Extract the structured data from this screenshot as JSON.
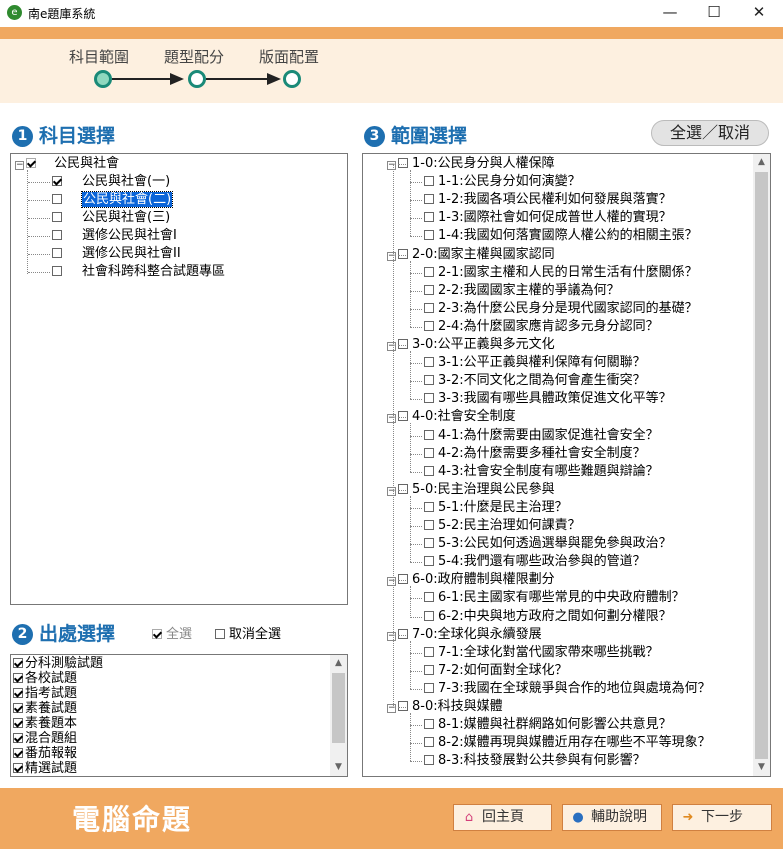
{
  "window": {
    "title": "南e題庫系統",
    "minimize": "—",
    "maximize": "☐",
    "close": "✕"
  },
  "steps": [
    "科目範圍",
    "題型配分",
    "版面配置"
  ],
  "section1": {
    "num": "1",
    "title": "科目選擇"
  },
  "subjects": {
    "root": {
      "label": "公民與社會",
      "checked": true
    },
    "items": [
      {
        "label": "公民與社會(一)",
        "checked": true,
        "selected": false
      },
      {
        "label": "公民與社會(二)",
        "checked": false,
        "selected": true
      },
      {
        "label": "公民與社會(三)",
        "checked": false,
        "selected": false
      },
      {
        "label": "選修公民與社會I",
        "checked": false,
        "selected": false
      },
      {
        "label": "選修公民與社會II",
        "checked": false,
        "selected": false
      },
      {
        "label": "社會科跨科整合試題專區",
        "checked": false,
        "selected": false
      }
    ]
  },
  "section2": {
    "num": "2",
    "title": "出處選擇",
    "select_all": "全選",
    "deselect_all": "取消全選"
  },
  "sources": [
    "分科測驗試題",
    "各校試題",
    "指考試題",
    "素養試題",
    "素養題本",
    "混合題組",
    "番茄報報",
    "精選試題"
  ],
  "section3": {
    "num": "3",
    "title": "範圍選擇",
    "toggle_button": "全選／取消"
  },
  "ranges": [
    {
      "label": "1-0:公民身分與人權保障",
      "children": [
        "1-1:公民身分如何演變？",
        "1-2:我國各項公民權利如何發展與落實？",
        "1-3:國際社會如何促成普世人權的實現？",
        "1-4:我國如何落實國際人權公約的相關主張？"
      ]
    },
    {
      "label": "2-0:國家主權與國家認同",
      "children": [
        "2-1:國家主權和人民的日常生活有什麼關係？",
        "2-2:我國國家主權的爭議為何？",
        "2-3:為什麼公民身分是現代國家認同的基礎？",
        "2-4:為什麼國家應肯認多元身分認同？"
      ]
    },
    {
      "label": "3-0:公平正義與多元文化",
      "children": [
        "3-1:公平正義與權利保障有何關聯？",
        "3-2:不同文化之間為何會產生衝突？",
        "3-3:我國有哪些具體政策促進文化平等？"
      ]
    },
    {
      "label": "4-0:社會安全制度",
      "children": [
        "4-1:為什麼需要由國家促進社會安全？",
        "4-2:為什麼需要多種社會安全制度？",
        "4-3:社會安全制度有哪些難題與辯論？"
      ]
    },
    {
      "label": "5-0:民主治理與公民參與",
      "children": [
        "5-1:什麼是民主治理？",
        "5-2:民主治理如何課責？",
        "5-3:公民如何透過選舉與罷免參與政治？",
        "5-4:我們還有哪些政治參與的管道？"
      ]
    },
    {
      "label": "6-0:政府體制與權限劃分",
      "children": [
        "6-1:民主國家有哪些常見的中央政府體制？",
        "6-2:中央與地方政府之間如何劃分權限？"
      ]
    },
    {
      "label": "7-0:全球化與永續發展",
      "children": [
        "7-1:全球化對當代國家帶來哪些挑戰？",
        "7-2:如何面對全球化？",
        "7-3:我國在全球競爭與合作的地位與處境為何？"
      ]
    },
    {
      "label": "8-0:科技與媒體",
      "children": [
        "8-1:媒體與社群網路如何影響公共意見？",
        "8-2:媒體再現與媒體近用存在哪些不平等現象？",
        "8-3:科技發展對公共參與有何影響？"
      ]
    }
  ],
  "footer": {
    "brand": "電腦命題",
    "home": "回主頁",
    "help": "輔助說明",
    "next": "下一步"
  },
  "colors": {
    "accent": "#1e6fb0",
    "orange": "#f0a860",
    "step": "#1a8a78"
  }
}
